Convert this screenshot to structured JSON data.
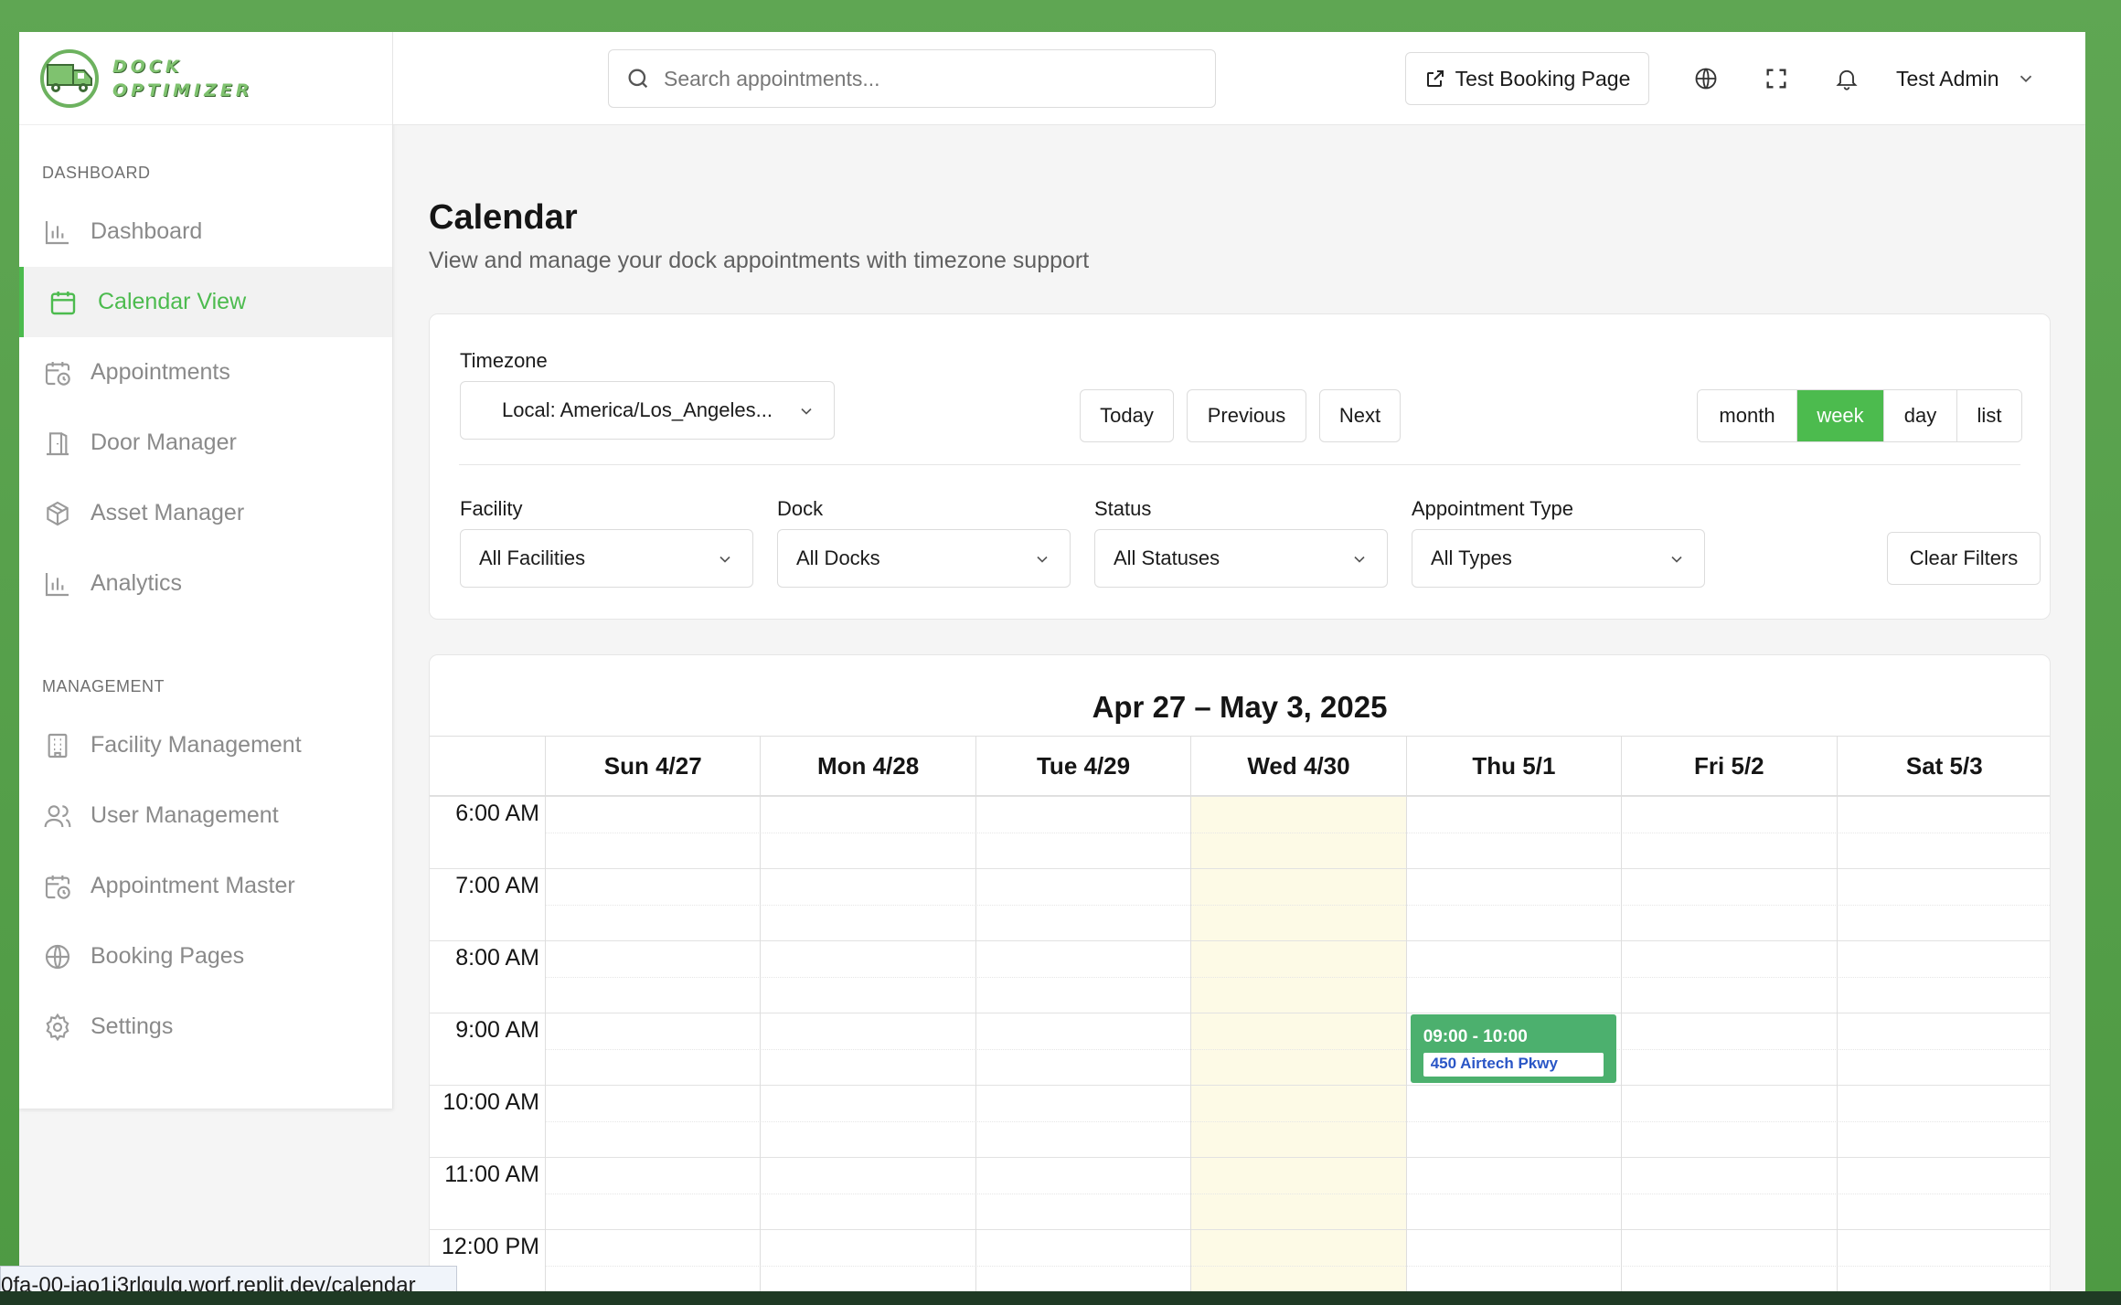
{
  "brand": {
    "line1": "DOCK",
    "line2": "OPTIMIZER"
  },
  "sidebar": {
    "sections": [
      {
        "title": "DASHBOARD",
        "items": [
          {
            "label": "Dashboard",
            "icon": "bar-chart-icon",
            "active": false
          },
          {
            "label": "Calendar View",
            "icon": "calendar-icon",
            "active": true
          },
          {
            "label": "Appointments",
            "icon": "calendar-clock-icon",
            "active": false
          },
          {
            "label": "Door Manager",
            "icon": "door-icon",
            "active": false
          },
          {
            "label": "Asset Manager",
            "icon": "box-icon",
            "active": false
          },
          {
            "label": "Analytics",
            "icon": "bar-chart-icon",
            "active": false
          }
        ]
      },
      {
        "title": "MANAGEMENT",
        "items": [
          {
            "label": "Facility Management",
            "icon": "building-icon",
            "active": false
          },
          {
            "label": "User Management",
            "icon": "users-icon",
            "active": false
          },
          {
            "label": "Appointment Master",
            "icon": "calendar-clock-icon",
            "active": false
          },
          {
            "label": "Booking Pages",
            "icon": "globe-icon",
            "active": false
          },
          {
            "label": "Settings",
            "icon": "gear-icon",
            "active": false
          }
        ]
      }
    ]
  },
  "header": {
    "search_placeholder": "Search appointments...",
    "booking_button": "Test Booking Page",
    "user_name": "Test Admin",
    "icons": [
      "globe-icon",
      "fullscreen-icon",
      "bell-icon"
    ]
  },
  "page": {
    "title": "Calendar",
    "subtitle": "View and manage your dock appointments with timezone support"
  },
  "filters": {
    "timezone_label": "Timezone",
    "timezone_value": "Local: America/Los_Angeles...",
    "today": "Today",
    "previous": "Previous",
    "next": "Next",
    "views": [
      {
        "label": "month",
        "active": false
      },
      {
        "label": "week",
        "active": true
      },
      {
        "label": "day",
        "active": false
      },
      {
        "label": "list",
        "active": false
      }
    ],
    "facility_label": "Facility",
    "facility_value": "All Facilities",
    "dock_label": "Dock",
    "dock_value": "All Docks",
    "status_label": "Status",
    "status_value": "All Statuses",
    "type_label": "Appointment Type",
    "type_value": "All Types",
    "clear": "Clear Filters"
  },
  "calendar": {
    "range_title": "Apr 27 – May 3, 2025",
    "days": [
      "Sun 4/27",
      "Mon 4/28",
      "Tue 4/29",
      "Wed 4/30",
      "Thu 5/1",
      "Fri 5/2",
      "Sat 5/3"
    ],
    "today_index": 3,
    "hours": [
      "6:00 AM",
      "7:00 AM",
      "8:00 AM",
      "9:00 AM",
      "10:00 AM",
      "11:00 AM",
      "12:00 PM"
    ],
    "events": [
      {
        "day_index": 4,
        "start_hour_index": 3,
        "duration_hours": 1,
        "time": "09:00 - 10:00",
        "location": "450 Airtech Pkwy",
        "color": "#4cb06e"
      }
    ]
  },
  "status_url": "0fa-00-iao1i3rlgulq.worf.replit.dev/calendar",
  "colors": {
    "accent": "#4cbb4e",
    "today_bg": "#fdfae6",
    "event": "#4cb06e"
  }
}
